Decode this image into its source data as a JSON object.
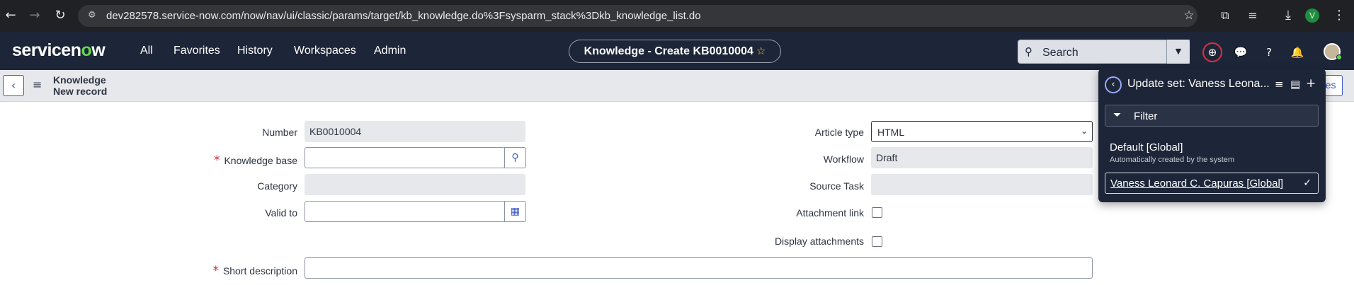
{
  "browser": {
    "url": "dev282578.service-now.com/now/nav/ui/classic/params/target/kb_knowledge.do%3Fsysparm_stack%3Dkb_knowledge_list.do",
    "profile_initial": "V"
  },
  "header": {
    "logo_pre": "servicen",
    "logo_o": "o",
    "logo_post": "w",
    "nav": [
      "All",
      "Favorites",
      "History",
      "Workspaces",
      "Admin"
    ],
    "context_title": "Knowledge - Create KB0010004",
    "search_placeholder": "Search"
  },
  "form_bar": {
    "title_line1": "Knowledge",
    "title_line2": "New record",
    "right_button_partial": "ates"
  },
  "form": {
    "number_label": "Number",
    "number_value": "KB0010004",
    "knowledge_base_label": "Knowledge base",
    "knowledge_base_value": "",
    "category_label": "Category",
    "category_value": "",
    "valid_to_label": "Valid to",
    "valid_to_value": "",
    "article_type_label": "Article type",
    "article_type_value": "HTML",
    "workflow_label": "Workflow",
    "workflow_value": "Draft",
    "source_task_label": "Source Task",
    "source_task_value": "",
    "attachment_link_label": "Attachment link",
    "display_attachments_label": "Display attachments",
    "short_description_label": "Short description",
    "short_description_value": ""
  },
  "update_set_popover": {
    "title": "Update set: Vaness Leona...",
    "filter_label": "Filter",
    "options": [
      {
        "name": "Default [Global]",
        "subtitle": "Automatically created by the system"
      },
      {
        "name": "Vaness Leonard C. Capuras [Global]",
        "selected": true
      }
    ]
  },
  "colors": {
    "sn_header": "#1d2638",
    "accent": "#3c59c2",
    "required": "#d2283a",
    "logo_green": "#62d84e"
  }
}
